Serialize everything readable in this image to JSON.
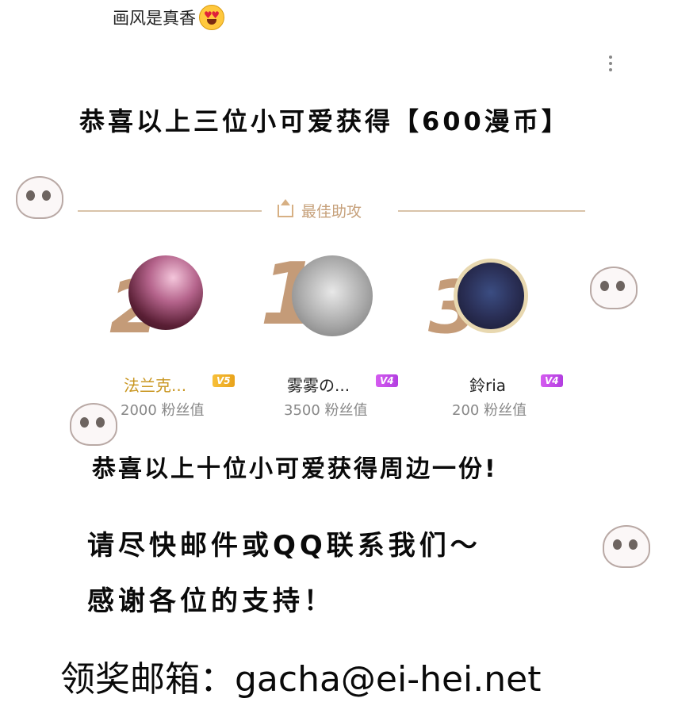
{
  "comment": {
    "text": "画风是真香"
  },
  "announcement_1": "恭喜以上三位小可爱获得【600漫币】",
  "leaderboard": {
    "title": "最佳助攻",
    "entries": [
      {
        "rank": "2",
        "name": "法兰克...",
        "badge": "V5",
        "fans": "2000 粉丝值"
      },
      {
        "rank": "1",
        "name": "雾雾の...",
        "badge": "V4",
        "fans": "3500 粉丝值"
      },
      {
        "rank": "3",
        "name": "鈴ria",
        "badge": "V4",
        "fans": "200 粉丝值"
      }
    ]
  },
  "announcement_2": "恭喜以上十位小可爱获得周边一份!",
  "announcement_3": "请尽快邮件或QQ联系我们～",
  "announcement_4": "感谢各位的支持！",
  "contact": "领奖邮箱：gacha@ei-hei.net",
  "colors": {
    "accent_tan": "#c49b78",
    "gold": "#c99620",
    "purple": "#b23ee0"
  }
}
